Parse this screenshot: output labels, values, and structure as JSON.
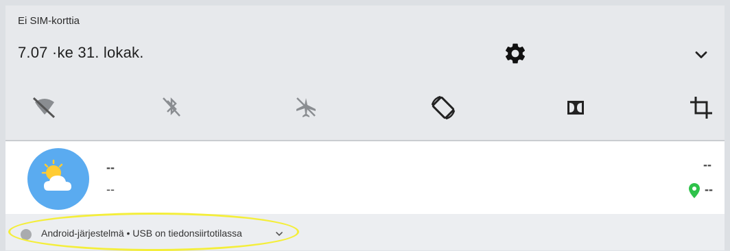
{
  "status": {
    "carrier": "Ei SIM-korttia"
  },
  "header": {
    "clock": "7.07 ·ke 31. lokak."
  },
  "icons": {
    "settings": "gear-icon",
    "expand": "chevron-down-icon"
  },
  "quick_settings": [
    {
      "icon": "wifi-off-icon"
    },
    {
      "icon": "bluetooth-off-icon"
    },
    {
      "icon": "airplane-mode-off-icon"
    },
    {
      "icon": "auto-rotate-icon"
    },
    {
      "icon": "dolby-icon"
    },
    {
      "icon": "crop-icon"
    }
  ],
  "weather": {
    "line1": "--",
    "line2": "--",
    "right1": "--",
    "right2": "--"
  },
  "notification": {
    "text": "Android-järjestelmä • USB on tiedonsiirtotilassa"
  },
  "colors": {
    "weather_badge": "#5aabf0",
    "location_pin": "#2ec24a",
    "highlight": "#f4ee3a"
  }
}
